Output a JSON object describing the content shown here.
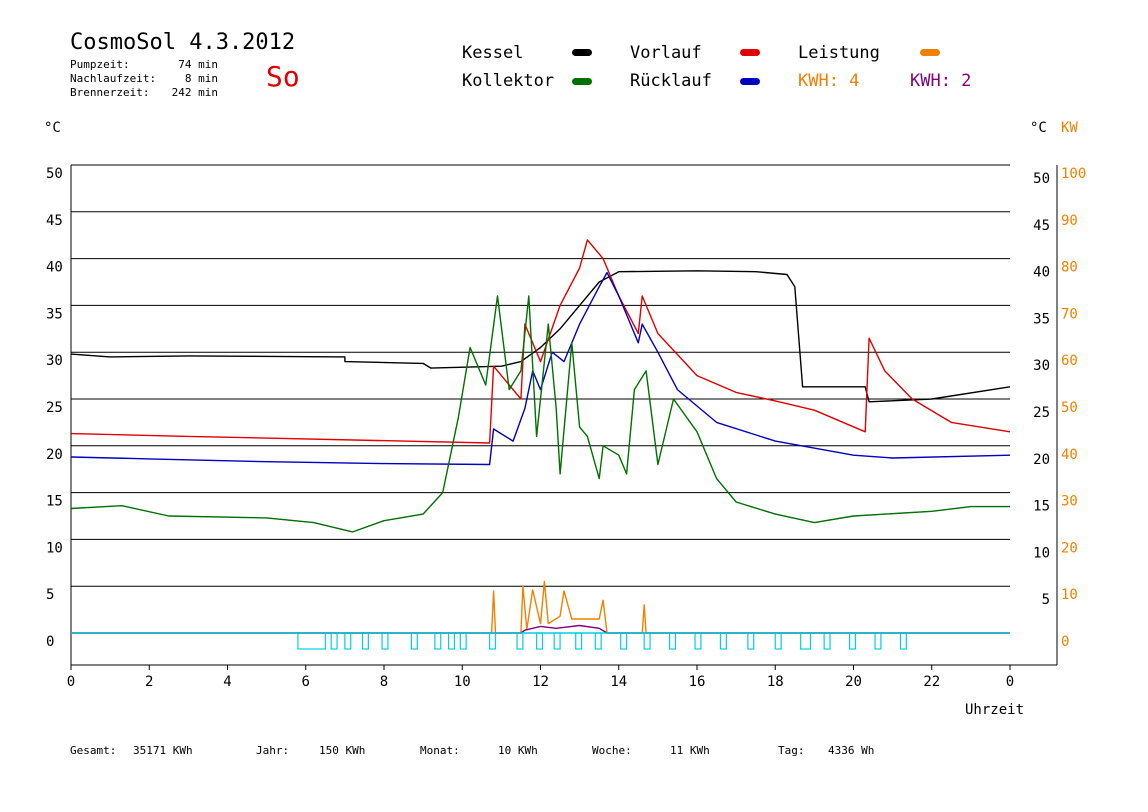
{
  "header": {
    "title": "CosmoSol 4.3.2012",
    "day": "So",
    "stats": [
      {
        "label": "Pumpzeit:",
        "value": "74 min"
      },
      {
        "label": "Nachlaufzeit:",
        "value": "8 min"
      },
      {
        "label": "Brennerzeit:",
        "value": "242 min"
      }
    ]
  },
  "legend": {
    "kessel": "Kessel",
    "vorlauf": "Vorlauf",
    "leistung": "Leistung",
    "kollektor": "Kollektor",
    "ruecklauf": "Rücklauf",
    "kwh1": "KWH: 4",
    "kwh2": "KWH: 2"
  },
  "axes": {
    "left_unit": "°C",
    "right_unit_c": "°C",
    "right_unit_kw": "KW",
    "xlabel": "Uhrzeit"
  },
  "footer": {
    "gesamt_label": "Gesamt:",
    "gesamt": "35171 KWh",
    "jahr_label": "Jahr:",
    "jahr": "150 KWh",
    "monat_label": "Monat:",
    "monat": "10 KWh",
    "woche_label": "Woche:",
    "woche": "11 KWh",
    "tag_label": "Tag:",
    "tag": "4336 Wh"
  },
  "colors": {
    "kessel": "#000000",
    "vorlauf": "#e00000",
    "ruecklauf": "#0000c0",
    "kollektor": "#007000",
    "leistung": "#f08000",
    "kwh2": "#800080",
    "pump": "#00d0e0"
  },
  "chart_data": {
    "type": "line",
    "xlim": [
      0,
      24
    ],
    "ylim": [
      0,
      50
    ],
    "y2lim": [
      0,
      100
    ],
    "x_ticks": [
      "0",
      "2",
      "4",
      "6",
      "8",
      "10",
      "12",
      "14",
      "16",
      "18",
      "20",
      "22",
      "0"
    ],
    "y_ticks": [
      "0",
      "5",
      "10",
      "15",
      "20",
      "25",
      "30",
      "35",
      "40",
      "45",
      "50"
    ],
    "y2_c_ticks": [
      "5",
      "10",
      "15",
      "20",
      "25",
      "30",
      "35",
      "40",
      "45",
      "50"
    ],
    "y2_kw_ticks": [
      "0",
      "10",
      "20",
      "30",
      "40",
      "50",
      "60",
      "70",
      "80",
      "90",
      "100"
    ],
    "series": [
      {
        "key": "kessel",
        "name": "Kessel",
        "points": [
          [
            0,
            29.8
          ],
          [
            1,
            29.5
          ],
          [
            3,
            29.6
          ],
          [
            7,
            29.5
          ],
          [
            7,
            29.0
          ],
          [
            9,
            28.8
          ],
          [
            9.2,
            28.3
          ],
          [
            11,
            28.5
          ],
          [
            11.5,
            29.0
          ],
          [
            12,
            30.5
          ],
          [
            12.5,
            32.5
          ],
          [
            13,
            35
          ],
          [
            13.5,
            37.5
          ],
          [
            14,
            38.6
          ],
          [
            16,
            38.7
          ],
          [
            17.5,
            38.6
          ],
          [
            18.3,
            38.3
          ],
          [
            18.5,
            37
          ],
          [
            18.7,
            26.3
          ],
          [
            20.3,
            26.3
          ],
          [
            20.4,
            24.7
          ],
          [
            22,
            25.0
          ],
          [
            24,
            26.3
          ]
        ]
      },
      {
        "key": "vorlauf",
        "name": "Vorlauf",
        "points": [
          [
            0,
            21.3
          ],
          [
            3,
            21.0
          ],
          [
            8.5,
            20.5
          ],
          [
            10.7,
            20.3
          ],
          [
            10.8,
            28.5
          ],
          [
            11.5,
            25
          ],
          [
            11.6,
            33
          ],
          [
            12,
            29
          ],
          [
            12.5,
            35
          ],
          [
            13,
            39
          ],
          [
            13.2,
            42
          ],
          [
            13.6,
            40
          ],
          [
            14,
            36
          ],
          [
            14.5,
            32
          ],
          [
            14.6,
            36
          ],
          [
            15,
            32
          ],
          [
            16,
            27.5
          ],
          [
            17,
            25.7
          ],
          [
            18,
            24.8
          ],
          [
            19,
            23.8
          ],
          [
            20.3,
            21.5
          ],
          [
            20.4,
            31.5
          ],
          [
            20.8,
            28
          ],
          [
            21.5,
            25
          ],
          [
            22.5,
            22.5
          ],
          [
            24,
            21.5
          ]
        ]
      },
      {
        "key": "ruecklauf",
        "name": "Rücklauf",
        "points": [
          [
            0,
            18.8
          ],
          [
            2,
            18.6
          ],
          [
            5,
            18.3
          ],
          [
            8,
            18.1
          ],
          [
            10.7,
            18.0
          ],
          [
            10.8,
            21.8
          ],
          [
            11.3,
            20.5
          ],
          [
            11.6,
            24
          ],
          [
            11.8,
            28
          ],
          [
            12,
            26
          ],
          [
            12.3,
            30
          ],
          [
            12.6,
            29
          ],
          [
            13,
            33
          ],
          [
            13.5,
            37
          ],
          [
            13.7,
            38.5
          ],
          [
            14,
            36
          ],
          [
            14.5,
            31
          ],
          [
            14.6,
            33
          ],
          [
            15,
            30
          ],
          [
            15.5,
            26
          ],
          [
            16.5,
            22.5
          ],
          [
            18,
            20.5
          ],
          [
            20,
            19.0
          ],
          [
            21,
            18.7
          ],
          [
            24,
            19.0
          ]
        ]
      },
      {
        "key": "kollektor",
        "name": "Kollektor",
        "points": [
          [
            0,
            13.3
          ],
          [
            1.3,
            13.6
          ],
          [
            2.5,
            12.5
          ],
          [
            5,
            12.3
          ],
          [
            6.2,
            11.8
          ],
          [
            7.2,
            10.8
          ],
          [
            8,
            12.0
          ],
          [
            9,
            12.7
          ],
          [
            9.5,
            15
          ],
          [
            9.9,
            23
          ],
          [
            10.2,
            30.5
          ],
          [
            10.6,
            26.5
          ],
          [
            10.9,
            36
          ],
          [
            11.2,
            26
          ],
          [
            11.5,
            28
          ],
          [
            11.7,
            36
          ],
          [
            11.9,
            21
          ],
          [
            12.2,
            33
          ],
          [
            12.4,
            24
          ],
          [
            12.5,
            17
          ],
          [
            12.8,
            31
          ],
          [
            13,
            22
          ],
          [
            13.2,
            21
          ],
          [
            13.5,
            16.5
          ],
          [
            13.6,
            20
          ],
          [
            14,
            19
          ],
          [
            14.2,
            17
          ],
          [
            14.4,
            26
          ],
          [
            14.7,
            28
          ],
          [
            15,
            18
          ],
          [
            15.4,
            25
          ],
          [
            16,
            21.5
          ],
          [
            16.5,
            16.5
          ],
          [
            17,
            14
          ],
          [
            18,
            12.7
          ],
          [
            19,
            11.8
          ],
          [
            20,
            12.5
          ],
          [
            22,
            13.0
          ],
          [
            23,
            13.5
          ],
          [
            24,
            13.5
          ]
        ]
      },
      {
        "key": "leistung",
        "name": "Leistung",
        "points": [
          [
            0,
            0
          ],
          [
            10.75,
            0
          ],
          [
            10.8,
            4.5
          ],
          [
            10.85,
            0
          ],
          [
            11.5,
            0
          ],
          [
            11.55,
            5
          ],
          [
            11.65,
            0.4
          ],
          [
            11.8,
            4.6
          ],
          [
            12,
            1
          ],
          [
            12.1,
            5.5
          ],
          [
            12.2,
            1
          ],
          [
            12.5,
            1.8
          ],
          [
            12.6,
            4.5
          ],
          [
            12.8,
            1.5
          ],
          [
            13.5,
            1.5
          ],
          [
            13.6,
            3.5
          ],
          [
            13.7,
            0
          ],
          [
            14.6,
            0
          ],
          [
            14.65,
            3
          ],
          [
            14.7,
            0
          ],
          [
            24,
            0
          ]
        ]
      },
      {
        "key": "kwh2",
        "name": "KWH: 2",
        "points": [
          [
            0,
            0
          ],
          [
            11.5,
            0
          ],
          [
            11.6,
            0.3
          ],
          [
            12,
            0.7
          ],
          [
            12.4,
            0.5
          ],
          [
            13,
            0.8
          ],
          [
            13.5,
            0.5
          ],
          [
            13.7,
            0
          ],
          [
            24,
            0
          ]
        ]
      },
      {
        "key": "pump",
        "name": "",
        "points": [
          [
            0,
            0
          ],
          [
            24,
            0
          ]
        ]
      }
    ]
  }
}
